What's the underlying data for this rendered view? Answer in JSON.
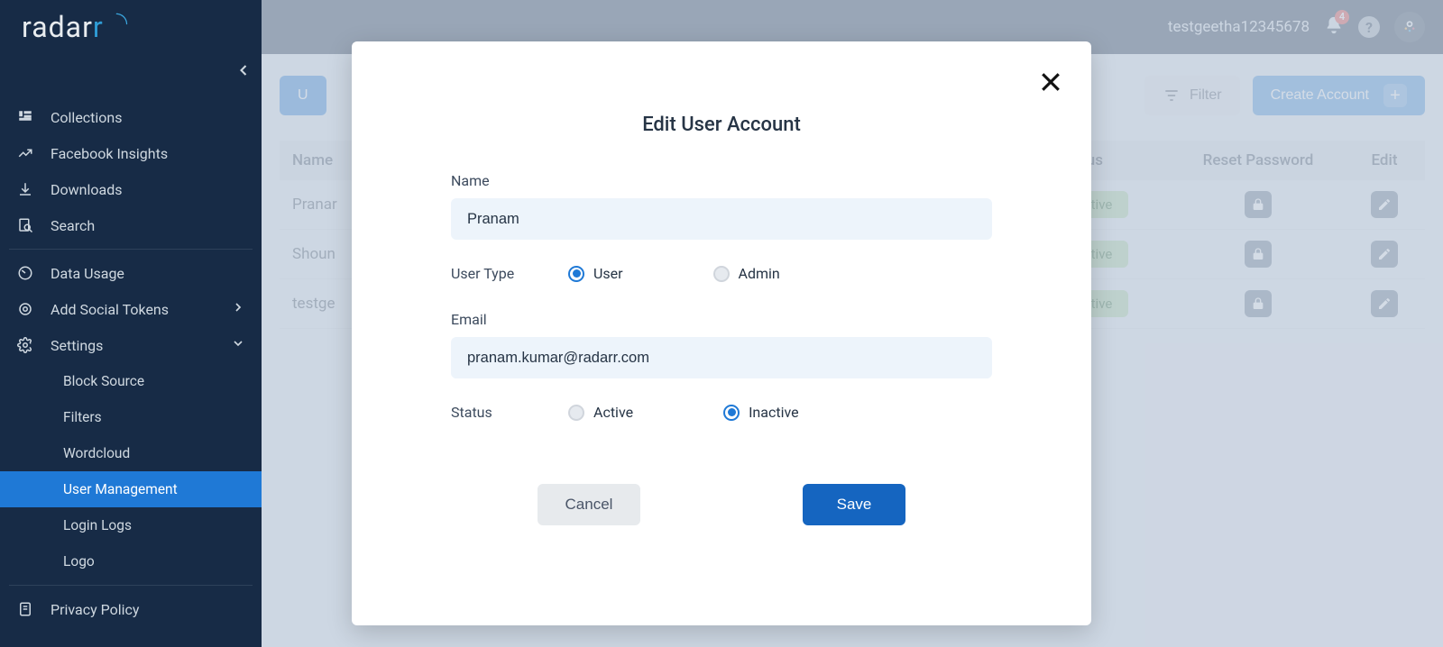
{
  "header": {
    "logo_text": "radar",
    "logo_accent": "r",
    "username": "testgeetha12345678",
    "notification_count": "4"
  },
  "sidebar": {
    "collections": "Collections",
    "fb_insights": "Facebook Insights",
    "downloads": "Downloads",
    "search": "Search",
    "data_usage": "Data Usage",
    "social_tokens": "Add Social Tokens",
    "settings": "Settings",
    "sub": {
      "block_source": "Block Source",
      "filters": "Filters",
      "wordcloud": "Wordcloud",
      "user_management": "User Management",
      "login_logs": "Login Logs",
      "logo": "Logo"
    },
    "privacy": "Privacy Policy"
  },
  "toolbar": {
    "users_btn": "U",
    "filter": "Filter",
    "create": "Create Account"
  },
  "table": {
    "headers": {
      "name": "Name",
      "status": "Status",
      "reset": "Reset Password",
      "edit": "Edit"
    },
    "rows": [
      {
        "name": "Pranar",
        "status": "Active"
      },
      {
        "name": "Shoun",
        "status": "Active"
      },
      {
        "name": "testge",
        "status": "Active"
      }
    ]
  },
  "modal": {
    "title": "Edit User Account",
    "name_label": "Name",
    "name_value": "Pranam",
    "usertype_label": "User Type",
    "usertype_user": "User",
    "usertype_admin": "Admin",
    "email_label": "Email",
    "email_value": "pranam.kumar@radarr.com",
    "status_label": "Status",
    "status_active": "Active",
    "status_inactive": "Inactive",
    "cancel": "Cancel",
    "save": "Save"
  }
}
